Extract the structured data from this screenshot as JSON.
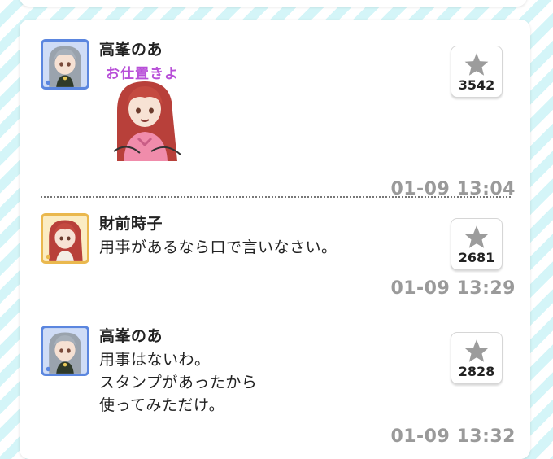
{
  "posts": [
    {
      "author": "高峯のあ",
      "stamp_text": "お仕置きよ",
      "likes": "3542",
      "timestamp": "01-09 13:04",
      "avatar_icon": "noa-avatar-icon"
    },
    {
      "author": "財前時子",
      "message": "用事があるなら口で言いなさい。",
      "likes": "2681",
      "timestamp": "01-09 13:29",
      "avatar_icon": "tokiko-avatar-icon"
    },
    {
      "author": "高峯のあ",
      "message": "用事はないわ。\nスタンプがあったから\n使ってみただけ。",
      "likes": "2828",
      "timestamp": "01-09 13:32",
      "avatar_icon": "noa-avatar-icon"
    }
  ],
  "colors": {
    "timestamp": "#9a9a9a",
    "star": "#9c9c9c",
    "stamp_text": "#b84fd8",
    "avatar_blue": "#6a95e8",
    "avatar_gold": "#f2c866"
  }
}
